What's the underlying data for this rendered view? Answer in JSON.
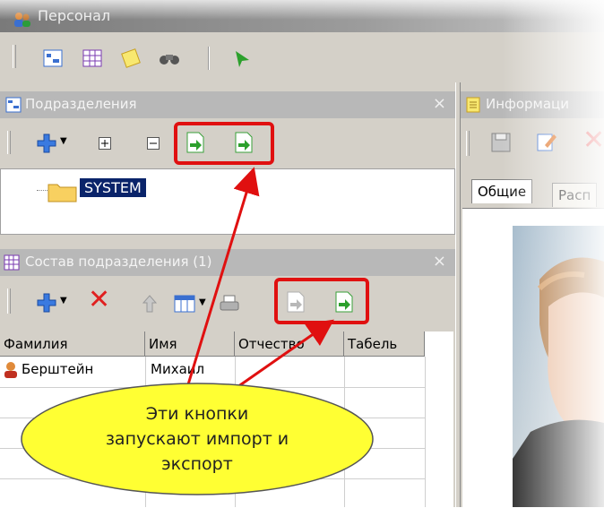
{
  "window": {
    "title": "Персонал"
  },
  "panels": {
    "departments": {
      "title": "Подразделения",
      "tree_item": "SYSTEM"
    },
    "staff": {
      "title": "Состав подразделения (1)",
      "columns": [
        "Фамилия",
        "Имя",
        "Отчество",
        "Табель"
      ],
      "rows": [
        {
          "surname": "Берштейн",
          "name": "Михаил"
        }
      ]
    },
    "info": {
      "title": "Информаци",
      "tabs": [
        "Общие",
        "Расп"
      ]
    }
  },
  "callout": {
    "lines": [
      "Эти кнопки",
      "запускают импорт и",
      "экспорт"
    ]
  },
  "colors": {
    "highlight": "#e01010",
    "callout_fill": "#ffff33",
    "selection": "#0a246a"
  }
}
